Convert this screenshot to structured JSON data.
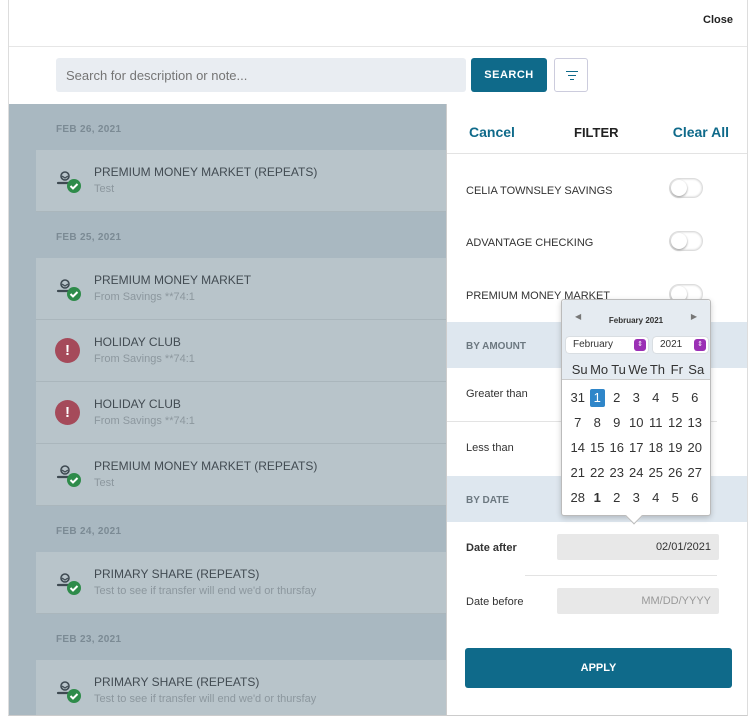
{
  "header": {
    "close_label": "Close"
  },
  "search": {
    "placeholder": "Search for description or note...",
    "button_label": "SEARCH"
  },
  "transactions": [
    {
      "date": "FEB 26, 2021",
      "items": [
        {
          "title": "PREMIUM MONEY MARKET (REPEATS)",
          "subtitle": "Test",
          "status": "success"
        }
      ]
    },
    {
      "date": "FEB 25, 2021",
      "items": [
        {
          "title": "PREMIUM MONEY MARKET",
          "subtitle": "From Savings **74:1",
          "status": "success"
        },
        {
          "title": "HOLIDAY CLUB",
          "subtitle": "From Savings **74:1",
          "status": "error"
        },
        {
          "title": "HOLIDAY CLUB",
          "subtitle": "From Savings **74:1",
          "status": "error"
        },
        {
          "title": "PREMIUM MONEY MARKET (REPEATS)",
          "subtitle": "Test",
          "status": "success"
        }
      ]
    },
    {
      "date": "FEB 24, 2021",
      "items": [
        {
          "title": "PRIMARY SHARE (REPEATS)",
          "subtitle": "Test to see if transfer will end we'd or thursfay",
          "status": "success"
        }
      ]
    },
    {
      "date": "FEB 23, 2021",
      "items": [
        {
          "title": "PRIMARY SHARE (REPEATS)",
          "subtitle": "Test to see if transfer will end we'd or thursfay",
          "status": "success"
        }
      ]
    }
  ],
  "filter": {
    "cancel": "Cancel",
    "title": "FILTER",
    "clear_all": "Clear All",
    "accounts": [
      {
        "label": "CELIA TOWNSLEY SAVINGS",
        "on": false
      },
      {
        "label": "ADVANTAGE CHECKING",
        "on": false
      },
      {
        "label": "PREMIUM MONEY MARKET",
        "on": false
      }
    ],
    "by_amount": "BY AMOUNT",
    "greater_than": "Greater than",
    "less_than": "Less than",
    "by_date": "BY DATE",
    "date_after": "Date after",
    "date_after_value": "02/01/2021",
    "date_before": "Date before",
    "date_before_placeholder": "MM/DD/YYYY",
    "apply": "APPLY"
  },
  "calendar": {
    "title": "February 2021",
    "month": "February",
    "year": "2021",
    "weekdays": [
      "Su",
      "Mo",
      "Tu",
      "We",
      "Th",
      "Fr",
      "Sa"
    ],
    "days": [
      "31",
      "1",
      "2",
      "3",
      "4",
      "5",
      "6",
      "7",
      "8",
      "9",
      "10",
      "11",
      "12",
      "13",
      "14",
      "15",
      "16",
      "17",
      "18",
      "19",
      "20",
      "21",
      "22",
      "23",
      "24",
      "25",
      "26",
      "27",
      "28",
      "1",
      "2",
      "3",
      "4",
      "5",
      "6"
    ],
    "selected_index": 1,
    "today_index": 29
  },
  "colors": {
    "accent": "#0f6a8a",
    "success": "#2e8b4a",
    "error": "#a54a5a",
    "selected_day": "#2f86c9"
  }
}
